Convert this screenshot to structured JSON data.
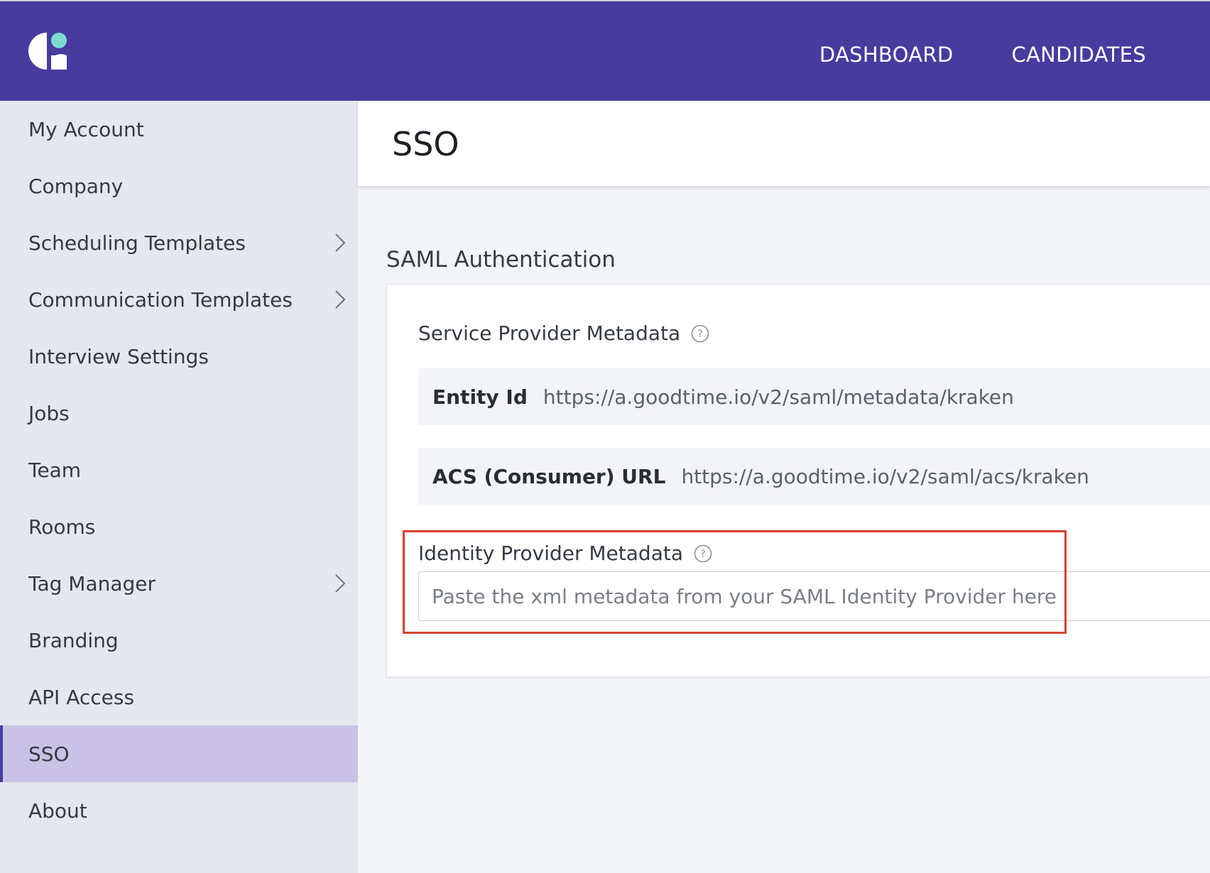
{
  "topnav": {
    "items": [
      {
        "label": "DASHBOARD"
      },
      {
        "label": "CANDIDATES"
      }
    ]
  },
  "sidebar": {
    "items": [
      {
        "label": "My Account"
      },
      {
        "label": "Company"
      },
      {
        "label": "Scheduling Templates"
      },
      {
        "label": "Communication Templates"
      },
      {
        "label": "Interview Settings"
      },
      {
        "label": "Jobs"
      },
      {
        "label": "Team"
      },
      {
        "label": "Rooms"
      },
      {
        "label": "Tag Manager"
      },
      {
        "label": "Branding"
      },
      {
        "label": "API Access"
      },
      {
        "label": "SSO"
      },
      {
        "label": "About"
      }
    ],
    "active_item": "SSO"
  },
  "page": {
    "title": "SSO"
  },
  "saml": {
    "section_label": "SAML Authentication",
    "sp_metadata_label": "Service Provider Metadata",
    "entity_id_key": "Entity Id",
    "entity_id_value": "https://a.goodtime.io/v2/saml/metadata/kraken",
    "acs_key": "ACS (Consumer) URL",
    "acs_value": "https://a.goodtime.io/v2/saml/acs/kraken",
    "idp_metadata_label": "Identity Provider Metadata",
    "idp_placeholder": "Paste the xml metadata from your SAML Identity Provider here",
    "idp_value": ""
  },
  "colors": {
    "header_bg": "#473b9e",
    "logo_dot": "#7ddccf",
    "active_item_bg": "#c9c2e6",
    "highlight_border": "#d9412e"
  }
}
